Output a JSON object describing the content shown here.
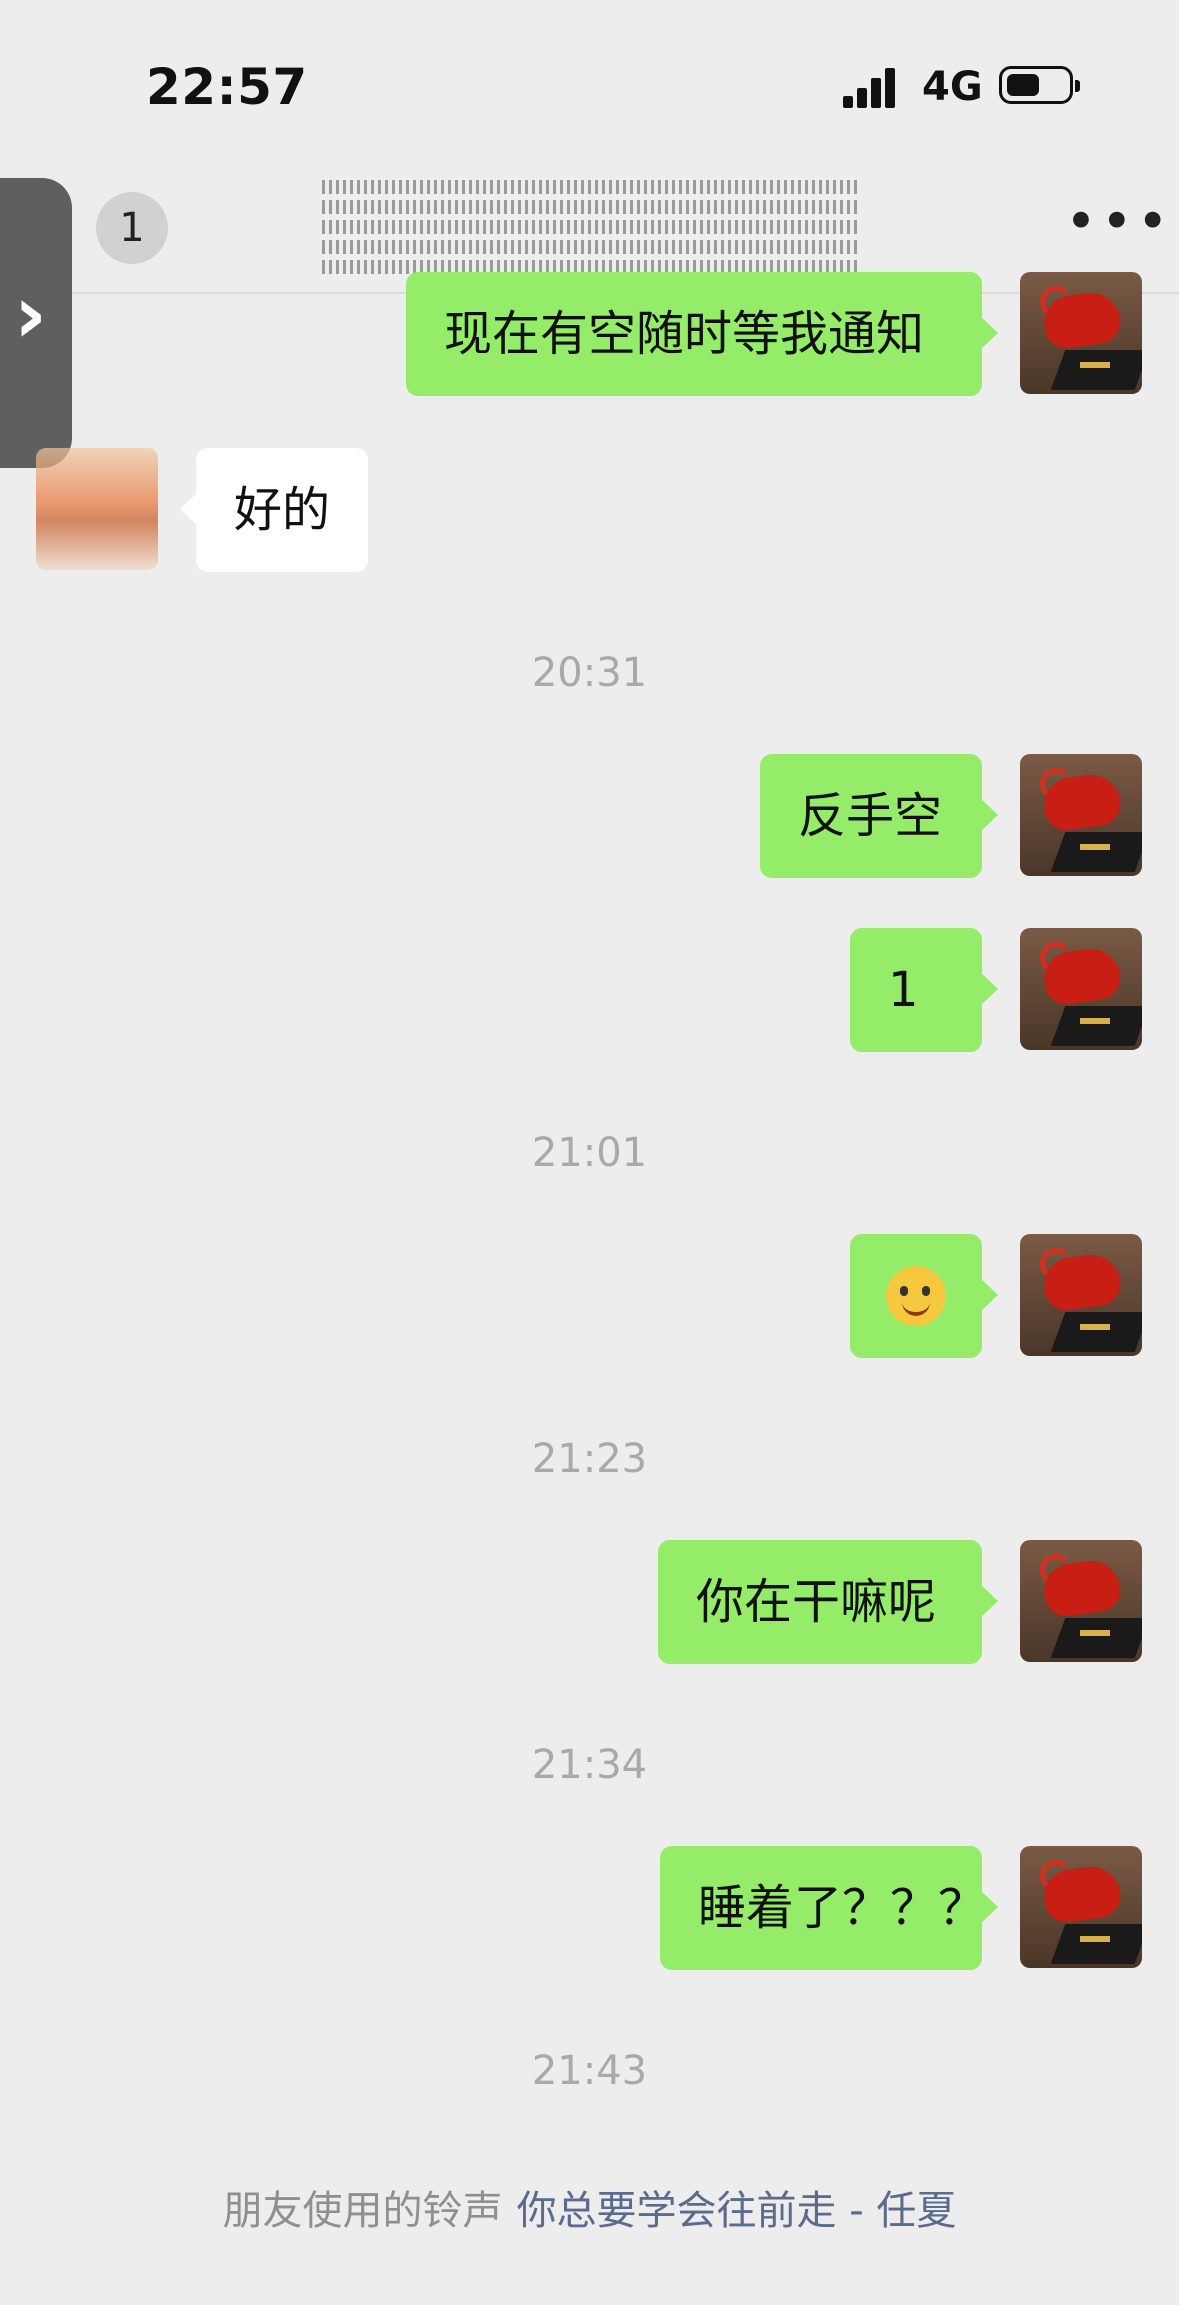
{
  "status_bar": {
    "time": "22:57",
    "network": "4G",
    "battery_level": 0.45
  },
  "nav": {
    "back_icon": "chevron-left-icon",
    "unread_count": "1",
    "more_icon": "more-icon"
  },
  "messages": [
    {
      "sender": "me",
      "text": "现在有空随时等我通知"
    },
    {
      "sender": "peer",
      "text": "好的"
    },
    {
      "time": "20:31"
    },
    {
      "sender": "me",
      "text": "反手空"
    },
    {
      "sender": "me",
      "text": "1"
    },
    {
      "time": "21:01"
    },
    {
      "sender": "me",
      "emoji": "smiling-face-emoji"
    },
    {
      "time": "21:23"
    },
    {
      "sender": "me",
      "text": "你在干嘛呢"
    },
    {
      "time": "21:34"
    },
    {
      "sender": "me",
      "text": "睡着了？？？"
    },
    {
      "time": "21:43"
    }
  ],
  "ringtone": {
    "label": "朋友使用的铃声",
    "song": "你总要学会往前走 - 任夏"
  },
  "colors": {
    "self_bubble": "#95ec69",
    "peer_bubble": "#ffffff",
    "background": "#ededed"
  }
}
